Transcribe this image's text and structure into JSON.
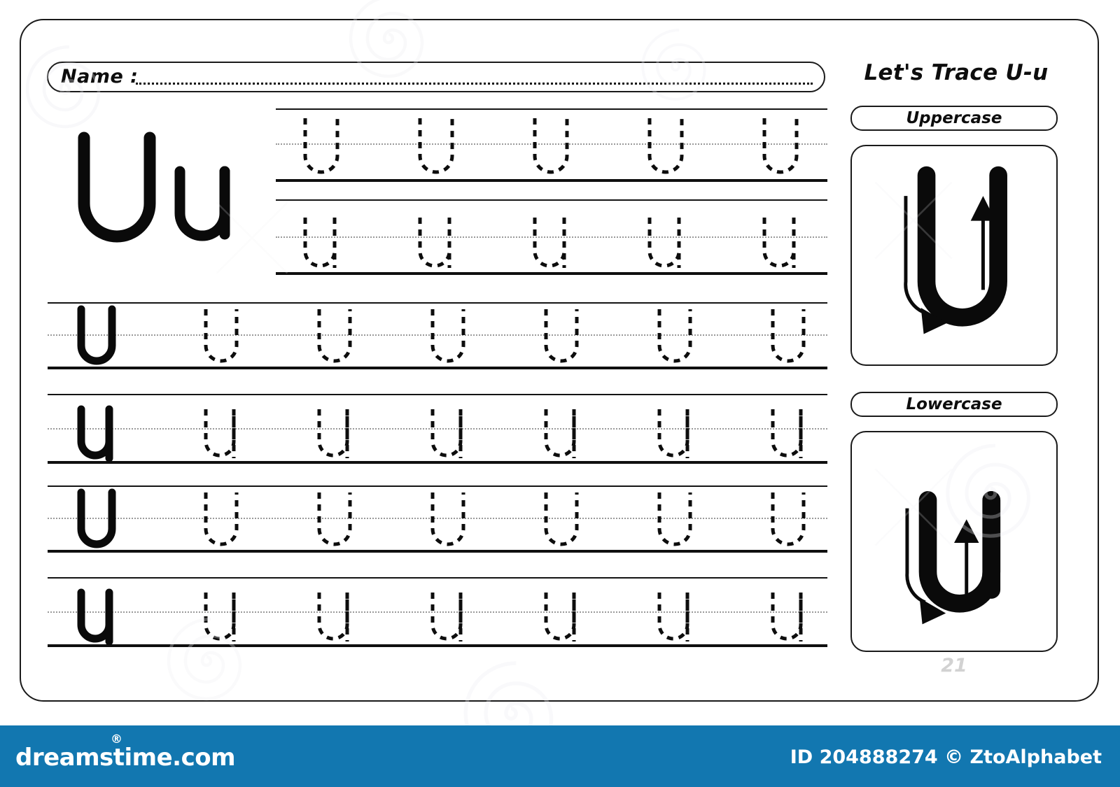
{
  "worksheet": {
    "title": "Let's Trace U-u",
    "page_number": "21",
    "name_field": {
      "label": "Name :",
      "value": "",
      "placeholder": ""
    },
    "display_letters": {
      "uppercase": "U",
      "lowercase": "u"
    },
    "sections": [
      {
        "id": "uppercase",
        "label": "Uppercase",
        "letter": "U"
      },
      {
        "id": "lowercase",
        "label": "Lowercase",
        "letter": "u"
      }
    ],
    "stroke_guides": [
      {
        "section": "uppercase",
        "letter": "U",
        "strokes": [
          {
            "order": 1,
            "direction": "down-curve-right",
            "arrow": "curved-down-arrow"
          },
          {
            "order": 2,
            "direction": "up",
            "arrow": "straight-up-arrow"
          }
        ]
      },
      {
        "section": "lowercase",
        "letter": "u",
        "strokes": [
          {
            "order": 1,
            "direction": "down-curve-right",
            "arrow": "curved-down-arrow"
          },
          {
            "order": 2,
            "direction": "up",
            "arrow": "straight-up-arrow"
          }
        ]
      }
    ],
    "trace_rows": [
      {
        "index": 1,
        "case": "uppercase",
        "letter": "U",
        "has_solid_model": false,
        "dashed_count": 5,
        "indent": "right"
      },
      {
        "index": 2,
        "case": "lowercase",
        "letter": "u",
        "has_solid_model": false,
        "dashed_count": 5,
        "indent": "right"
      },
      {
        "index": 3,
        "case": "uppercase",
        "letter": "U",
        "has_solid_model": true,
        "dashed_count": 6,
        "indent": "full"
      },
      {
        "index": 4,
        "case": "lowercase",
        "letter": "u",
        "has_solid_model": true,
        "dashed_count": 6,
        "indent": "full"
      },
      {
        "index": 5,
        "case": "uppercase",
        "letter": "U",
        "has_solid_model": true,
        "dashed_count": 6,
        "indent": "full"
      },
      {
        "index": 6,
        "case": "lowercase",
        "letter": "u",
        "has_solid_model": true,
        "dashed_count": 6,
        "indent": "full"
      }
    ]
  },
  "footer": {
    "site": "dreamstime.com",
    "registered_mark": "®",
    "credit": "ID 204888274 © ZtoAlphabet",
    "background_color": "#1277b0",
    "text_color": "#ffffff"
  },
  "colors": {
    "ink": "#0f0f0f",
    "guide_line": "#9a9a9a",
    "page_number": "#d2d2d2",
    "footer_blue": "#1277b0"
  }
}
